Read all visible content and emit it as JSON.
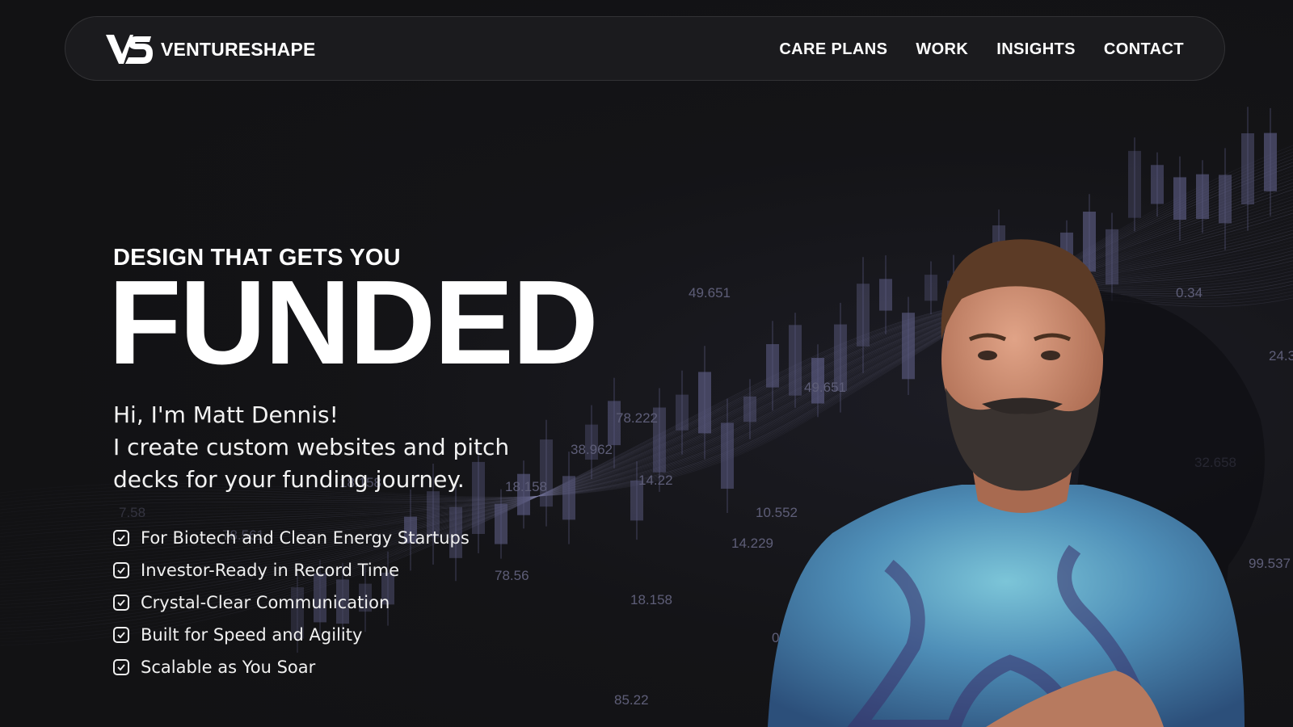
{
  "brand": {
    "name": "VENTURESHAPE",
    "logo_icon": "vs-monogram-icon"
  },
  "nav": {
    "items": [
      {
        "label": "CARE PLANS"
      },
      {
        "label": "WORK"
      },
      {
        "label": "INSIGHTS"
      },
      {
        "label": "CONTACT"
      }
    ]
  },
  "hero": {
    "eyebrow": "DESIGN THAT GETS YOU",
    "headline": "FUNDED",
    "intro_lines": [
      "Hi, I'm Matt Dennis!",
      "I create custom websites and pitch",
      "decks for your funding journey."
    ],
    "features": [
      {
        "label": "For Biotech and Clean Energy Startups",
        "icon": "checkbox-check-icon"
      },
      {
        "label": "Investor-Ready in Record Time",
        "icon": "checkbox-check-icon"
      },
      {
        "label": "Crystal-Clear Communication",
        "icon": "checkbox-check-icon"
      },
      {
        "label": "Built for Speed and Agility",
        "icon": "checkbox-check-icon"
      },
      {
        "label": "Scalable as You Soar",
        "icon": "checkbox-check-icon"
      }
    ]
  },
  "background": {
    "floating_numbers": [
      "49.651",
      "49.651",
      "78.222",
      "38.962",
      "18.158",
      "10.552",
      "14.229",
      "78.56",
      "18.158",
      "0.34",
      "0.34",
      "85.22",
      "24.3",
      "32.658",
      "99.537",
      "78.561",
      "7.58",
      "18.158",
      "14.22"
    ],
    "colors": {
      "background": "#121214",
      "candle": "#5a5a80",
      "wave": "#8a8ab0"
    }
  }
}
